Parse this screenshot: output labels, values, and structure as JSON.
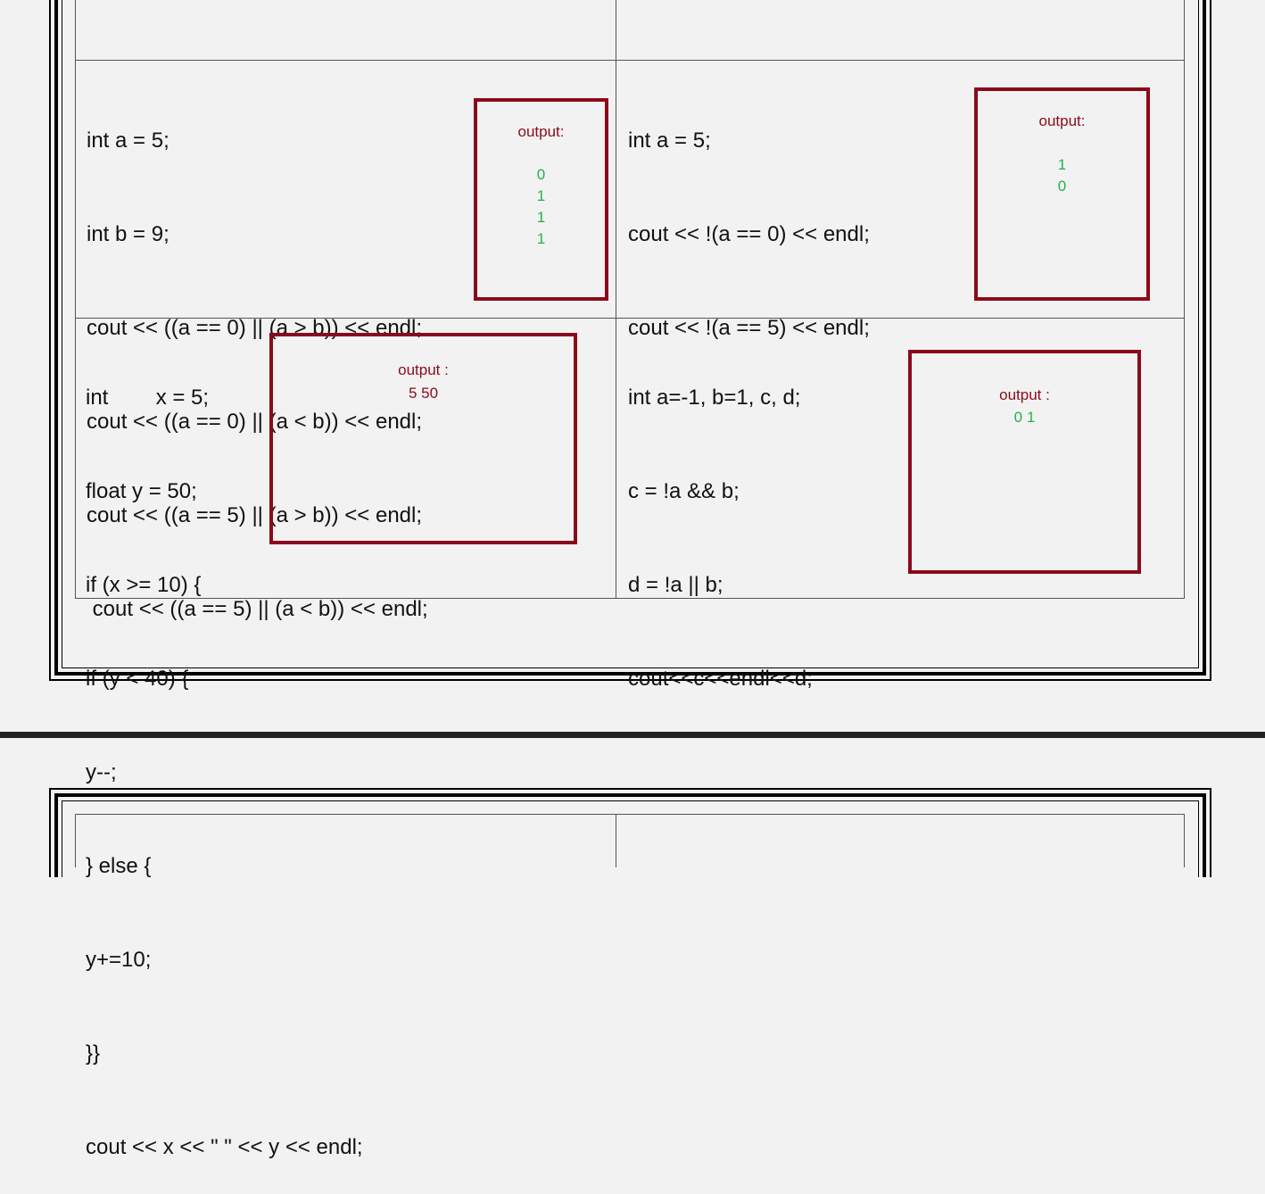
{
  "cells": {
    "top_left": {
      "code": [
        "int a = 5;",
        "int b = 9;",
        "cout << ((a == 0) || (a > b)) << endl;",
        "cout << ((a == 0) || (a < b)) << endl;",
        "cout << ((a == 5) || (a > b)) << endl;",
        " cout << ((a == 5) || (a < b)) << endl;"
      ],
      "output_label": "output:",
      "output_values": [
        "0",
        "1",
        "1",
        "1"
      ]
    },
    "top_right": {
      "code": [
        "int a = 5;",
        "cout << !(a == 0) << endl;",
        "cout << !(a == 5) << endl;"
      ],
      "output_label": "output:",
      "output_values": [
        "1",
        "0"
      ]
    },
    "bottom_left": {
      "code": [
        "int        x = 5;",
        "float y = 50;",
        "if (x >= 10) {",
        "if (y < 40) {",
        "y--;",
        "} else {",
        "y+=10;",
        "}}",
        "cout << x << \" \" << y << endl;"
      ],
      "output_label": "output :",
      "output_value": "5 50"
    },
    "bottom_right": {
      "code": [
        "int a=-1, b=1, c, d;",
        "c = !a && b;",
        "d = !a || b;",
        "cout<<c<<endl<<d;"
      ],
      "output_label": "output :",
      "output_value": "0 1"
    }
  },
  "colors": {
    "box_border": "#8b0a1a",
    "output_green": "#22b14c",
    "page_bg": "#f2f2f2"
  }
}
